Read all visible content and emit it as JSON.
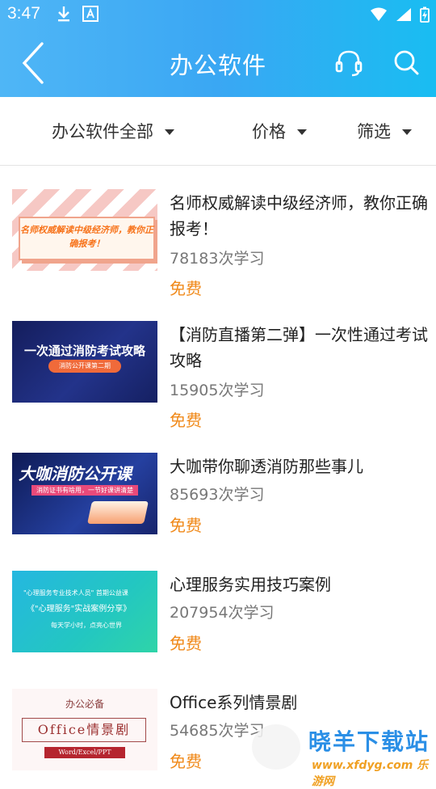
{
  "statusbar": {
    "time": "3:47"
  },
  "header": {
    "title": "办公软件"
  },
  "filters": [
    {
      "label": "办公软件全部"
    },
    {
      "label": "价格"
    },
    {
      "label": "筛选"
    }
  ],
  "courses": [
    {
      "title": "名师权威解读中级经济师，教你正确报考！",
      "count": "78183次学习",
      "price": "免费",
      "thumb_text": "名师权威解读中级经济师，教你正确报考！"
    },
    {
      "title": "【消防直播第二弹】一次性通过考试攻略",
      "count": "15905次学习",
      "price": "免费",
      "thumb_text": "一次通过消防考试攻略",
      "thumb_sub": "消防公开课第二期"
    },
    {
      "title": "大咖带你聊透消防那些事儿",
      "count": "85693次学习",
      "price": "免费",
      "thumb_text": "大咖消防公开课",
      "thumb_sub": "消防证书有啥用，一节好课讲清楚"
    },
    {
      "title": "心理服务实用技巧案例",
      "count": "207954次学习",
      "price": "免费",
      "thumb_text_1": "\"心理服务专业技术人员\" 首期公益课",
      "thumb_text_2": "《\"心理服务\"实战案例分享》",
      "thumb_text_3": "每天学小时，点亮心世界"
    },
    {
      "title": "Office系列情景剧",
      "count": "54685次学习",
      "price": "免费",
      "thumb_top": "办公必备",
      "thumb_main": "Office情景剧",
      "thumb_foot": "Word/Excel/PPT"
    }
  ],
  "watermark": {
    "line1": "晓羊下载站",
    "line2": "www.xfdyg.com 乐游网"
  },
  "colors": {
    "header_start": "#4fb6f6",
    "header_end": "#19bdf2",
    "price": "#f08a1b"
  }
}
